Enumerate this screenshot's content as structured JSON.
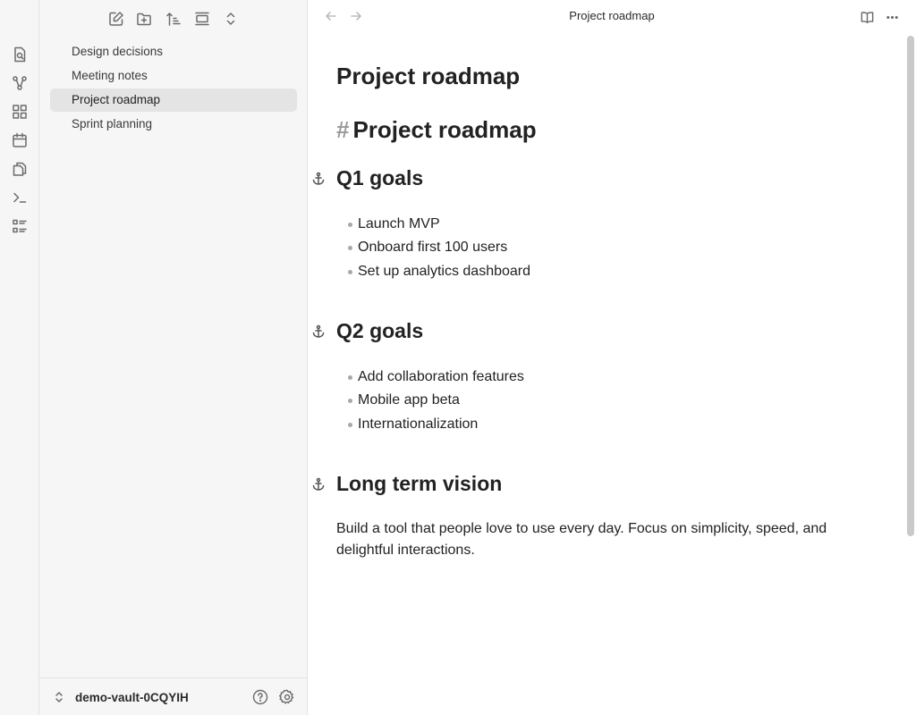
{
  "ribbon": {
    "icons": [
      "search-file-icon",
      "graph-icon",
      "grid-icon",
      "calendar-icon",
      "copy-icon",
      "terminal-icon",
      "checklist-icon"
    ]
  },
  "sidebar": {
    "toolbar": [
      "new-note-icon",
      "new-folder-icon",
      "sort-icon",
      "collapse-icon",
      "expand-icon"
    ],
    "files": [
      {
        "label": "Design decisions",
        "active": false
      },
      {
        "label": "Meeting notes",
        "active": false
      },
      {
        "label": "Project roadmap",
        "active": true
      },
      {
        "label": "Sprint planning",
        "active": false
      }
    ],
    "vault_name": "demo-vault-0CQYIH"
  },
  "main": {
    "tab_title": "Project roadmap",
    "inline_title": "Project roadmap",
    "h1": {
      "hash": "#",
      "text": "Project roadmap"
    },
    "sections": [
      {
        "heading": "Q1 goals",
        "items": [
          "Launch MVP",
          "Onboard first 100 users",
          "Set up analytics dashboard"
        ]
      },
      {
        "heading": "Q2 goals",
        "items": [
          "Add collaboration features",
          "Mobile app beta",
          "Internationalization"
        ]
      },
      {
        "heading": "Long term vision",
        "paragraph": "Build a tool that people love to use every day. Focus on simplicity, speed, and delightful interactions."
      }
    ]
  }
}
